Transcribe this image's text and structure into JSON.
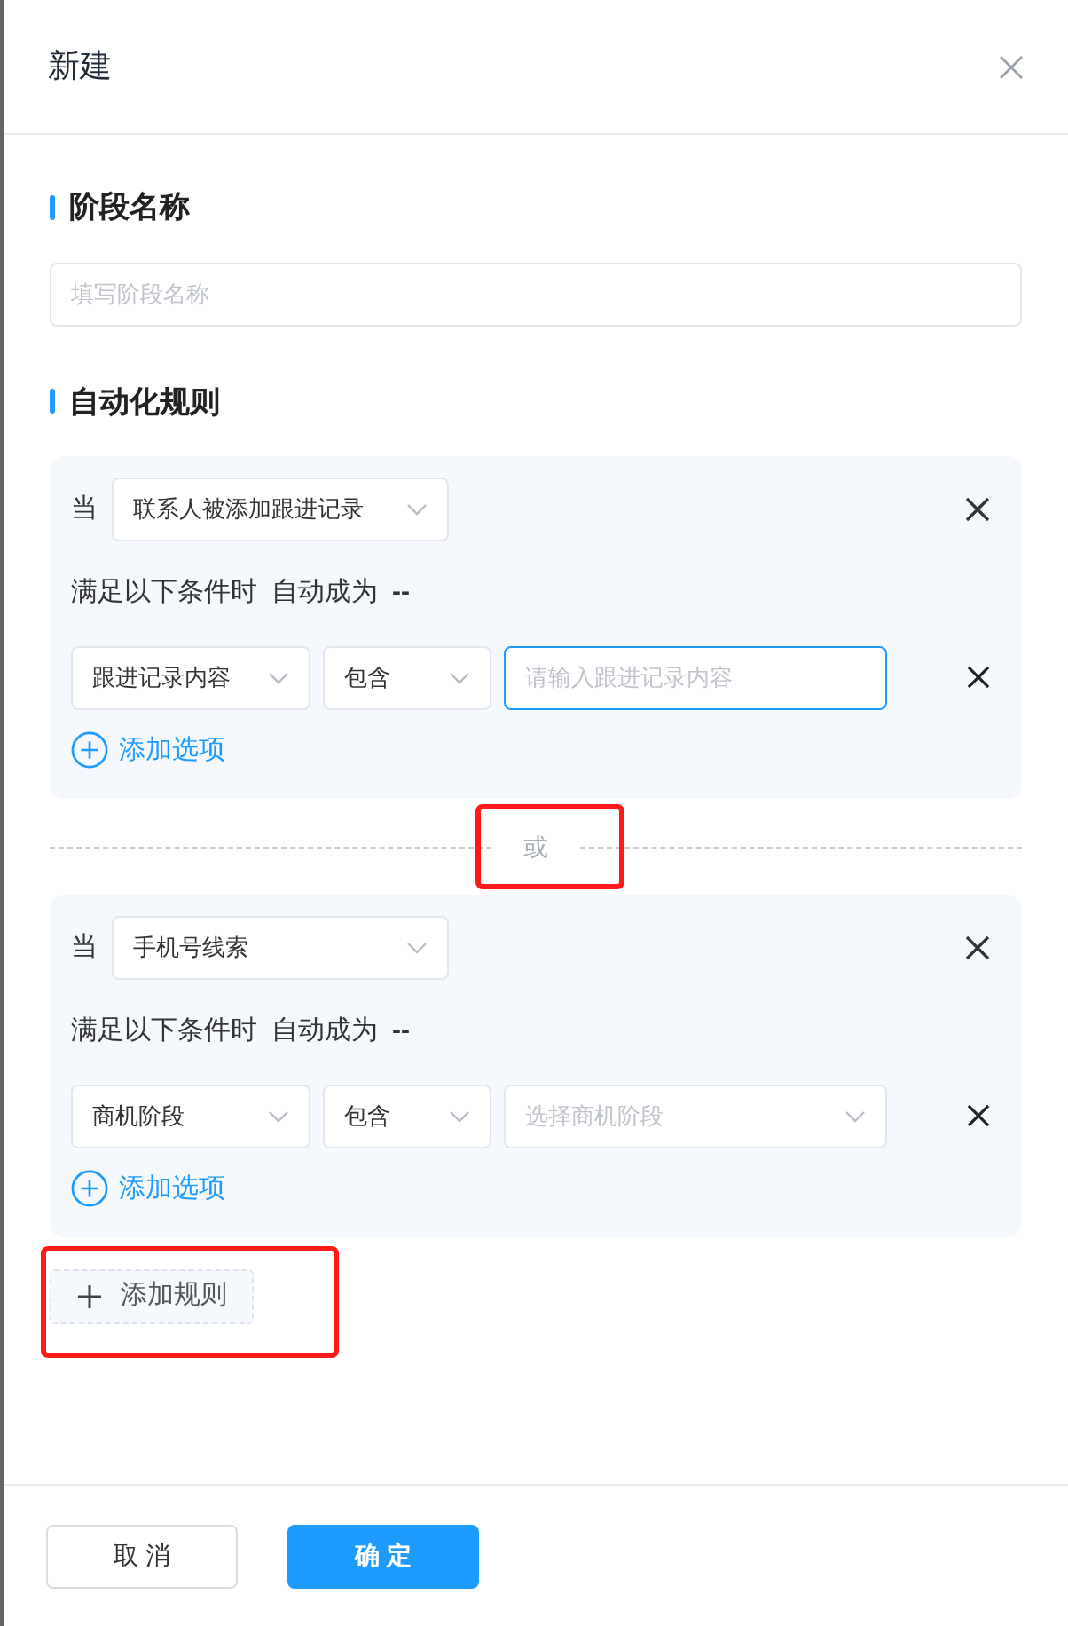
{
  "dialog": {
    "title": "新建"
  },
  "stage_name": {
    "heading": "阶段名称",
    "placeholder": "填写阶段名称"
  },
  "automation": {
    "heading": "自动化规则",
    "rules": [
      {
        "when_label": "当",
        "trigger": "联系人被添加跟进记录",
        "condition_text": "满足以下条件时",
        "result_label": "自动成为",
        "result_value": "--",
        "conditions": [
          {
            "field": "跟进记录内容",
            "operator": "包含",
            "value": {
              "kind": "input",
              "placeholder": "请输入跟进记录内容",
              "focused": true
            }
          }
        ],
        "add_option": "添加选项",
        "highlight": false
      },
      {
        "when_label": "当",
        "trigger": "手机号线索",
        "condition_text": "满足以下条件时",
        "result_label": "自动成为",
        "result_value": "--",
        "conditions": [
          {
            "field": "商机阶段",
            "operator": "包含",
            "value": {
              "kind": "select",
              "placeholder": "选择商机阶段",
              "focused": false
            }
          }
        ],
        "add_option": "添加选项",
        "highlight": false
      }
    ],
    "separator": {
      "text": "或",
      "highlight": true
    },
    "add_rule": {
      "label": "添加规则",
      "highlight": true
    }
  },
  "footer": {
    "buttons": [
      {
        "label": "取 消",
        "kind": "secondary"
      },
      {
        "label": "确 定",
        "kind": "primary"
      }
    ]
  }
}
